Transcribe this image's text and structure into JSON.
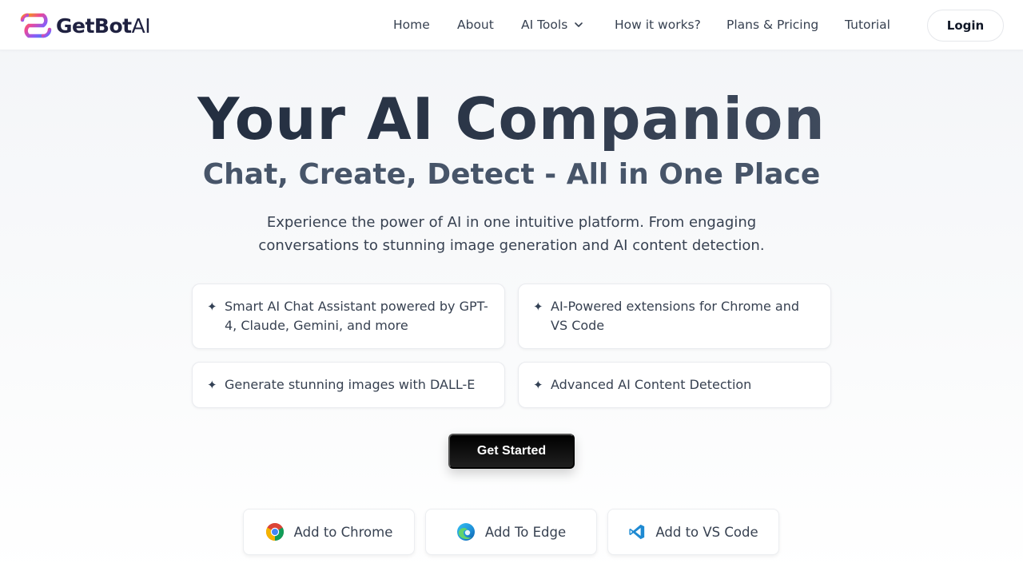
{
  "header": {
    "logo_text_main": "GetBot",
    "logo_text_ai": "AI",
    "nav": {
      "home": "Home",
      "about": "About",
      "ai_tools": "AI Tools",
      "how_it_works": "How it works?",
      "plans": "Plans & Pricing",
      "tutorial": "Tutorial"
    },
    "login_label": "Login"
  },
  "hero": {
    "title": "Your AI Companion",
    "subtitle": "Chat, Create, Detect - All in One Place",
    "description": "Experience the power of AI in one intuitive platform. From engaging conversations to stunning image generation and AI content detection."
  },
  "features": [
    {
      "text": "Smart AI Chat Assistant powered by GPT-4, Claude, Gemini, and more"
    },
    {
      "text": "AI-Powered extensions for Chrome and VS Code"
    },
    {
      "text": "Generate stunning images with DALL-E"
    },
    {
      "text": "Advanced AI Content Detection"
    }
  ],
  "feature_bullet": "✦",
  "cta_label": "Get Started",
  "extensions": [
    {
      "label": "Add to Chrome",
      "icon": "chrome-icon"
    },
    {
      "label": "Add To Edge",
      "icon": "edge-icon"
    },
    {
      "label": "Add to VS Code",
      "icon": "vscode-icon"
    }
  ],
  "colors": {
    "cta_bg": "#000000",
    "title": "#1e293b",
    "subtitle": "#475569"
  }
}
